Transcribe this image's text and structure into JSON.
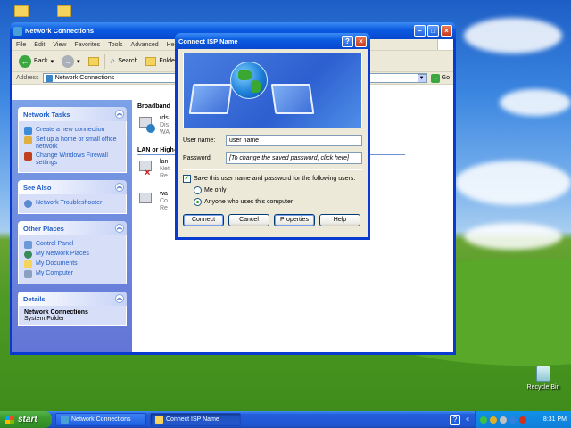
{
  "desktop": {
    "recycle_bin_label": "Recycle Bin"
  },
  "explorer": {
    "title": "Network Connections",
    "menu": [
      "File",
      "Edit",
      "View",
      "Favorites",
      "Tools",
      "Advanced",
      "Help"
    ],
    "toolbar": {
      "back": "Back",
      "search": "Search",
      "folders": "Folde"
    },
    "address": {
      "label": "Address",
      "value": "Network Connections",
      "go": "Go"
    },
    "sidebar": {
      "network_tasks": {
        "title": "Network Tasks",
        "items": [
          "Create a new connection",
          "Set up a home or small office network",
          "Change Windows Firewall settings"
        ]
      },
      "see_also": {
        "title": "See Also",
        "items": [
          "Network Troubleshooter"
        ]
      },
      "other_places": {
        "title": "Other Places",
        "items": [
          "Control Panel",
          "My Network Places",
          "My Documents",
          "My Computer"
        ]
      },
      "details": {
        "title": "Details",
        "name": "Network Connections",
        "type": "System Folder"
      }
    },
    "main": {
      "group_broadband": "Broadband",
      "group_lan": "LAN or High-",
      "connections": [
        {
          "line1": "rds",
          "line2": "Dis",
          "line3": "WA"
        },
        {
          "line1": "lan",
          "line2": "Net",
          "line3": "Re"
        },
        {
          "line1": "wa",
          "line2": "Co",
          "line3": "Re"
        }
      ]
    }
  },
  "dialog": {
    "title": "Connect ISP Name",
    "username_label": "User name:",
    "username_value": "user name",
    "password_label": "Password:",
    "password_placeholder": "[To change the saved password, click here]",
    "save_checkbox_label": "Save this user name and password for the following users:",
    "save_checked": true,
    "radio_me_only": "Me only",
    "radio_anyone": "Anyone who uses this computer",
    "selected_radio": "anyone",
    "buttons": {
      "connect": "Connect",
      "cancel": "Cancel",
      "properties": "Properties",
      "help": "Help"
    }
  },
  "taskbar": {
    "start": "start",
    "tasks": [
      "Network Connections",
      "Connect ISP Name"
    ],
    "active_task": 1,
    "clock": "8:31 PM"
  }
}
